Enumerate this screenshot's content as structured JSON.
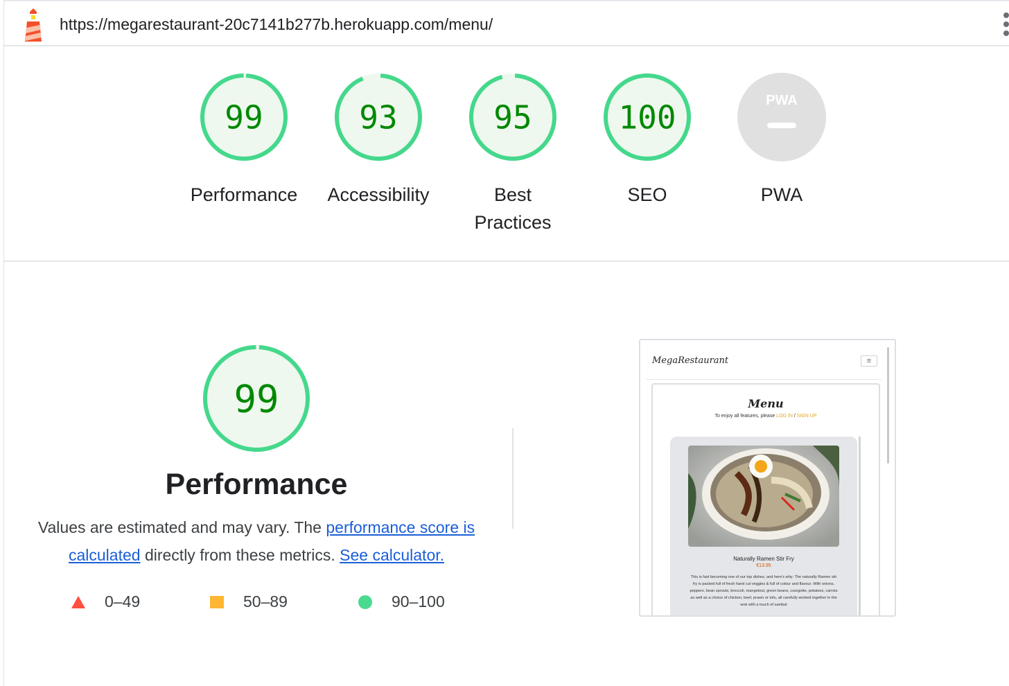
{
  "header": {
    "url": "https://megarestaurant-20c7141b277b.herokuapp.com/menu/",
    "logo_icon": "lighthouse-icon",
    "menu_icon": "kebab-menu-icon"
  },
  "colors": {
    "pass": "#0cce6b",
    "pass_text": "#008800",
    "pass_fill": "#eef8ee",
    "average": "#ffa400",
    "fail": "#ff4e42",
    "neutral": "#e0e0e0",
    "link": "#1a5fd6"
  },
  "categories": [
    {
      "label_lines": [
        "Performance"
      ],
      "score": "99",
      "fraction": 0.99
    },
    {
      "label_lines": [
        "Accessibility"
      ],
      "score": "93",
      "fraction": 0.93
    },
    {
      "label_lines": [
        "Best",
        "Practices"
      ],
      "score": "95",
      "fraction": 0.95
    },
    {
      "label_lines": [
        "SEO"
      ],
      "score": "100",
      "fraction": 1.0
    },
    {
      "label_lines": [
        "PWA"
      ],
      "score": "",
      "badge": "PWA",
      "fraction": null
    }
  ],
  "performance": {
    "score": "99",
    "fraction": 0.99,
    "title": "Performance",
    "desc_prefix": "Values are estimated and may vary. The ",
    "link1": "performance score is calculated",
    "desc_middle": " directly from these metrics. ",
    "link2": "See calculator.",
    "legend": [
      {
        "range": "0–49",
        "shape": "triangle"
      },
      {
        "range": "50–89",
        "shape": "square"
      },
      {
        "range": "90–100",
        "shape": "circle"
      }
    ]
  },
  "screenshot": {
    "brand": "MegaRestaurant",
    "toggler_icon": "hamburger-icon",
    "menu_title": "Menu",
    "login_prompt": "To enjoy all features, please ",
    "login": "LOG IN",
    "separator": " / ",
    "signup": "SIGN UP",
    "dish_name": "Naturally Ramen Stir Fry",
    "dish_price": "€13.95",
    "dish_description": "This is fast becoming one of our top dishes, and here's why: The naturally Ramen stir fry is packed full of fresh hand cut veggies & full of colour and flavour. With onions, peppers, bean sprouts, broccoli, mangetout, green beans, courgette, potatoes, carrots as well as a choice of chicken, beef, prawn or tofu, all carefully worked together in the wok with a touch of sambal"
  }
}
